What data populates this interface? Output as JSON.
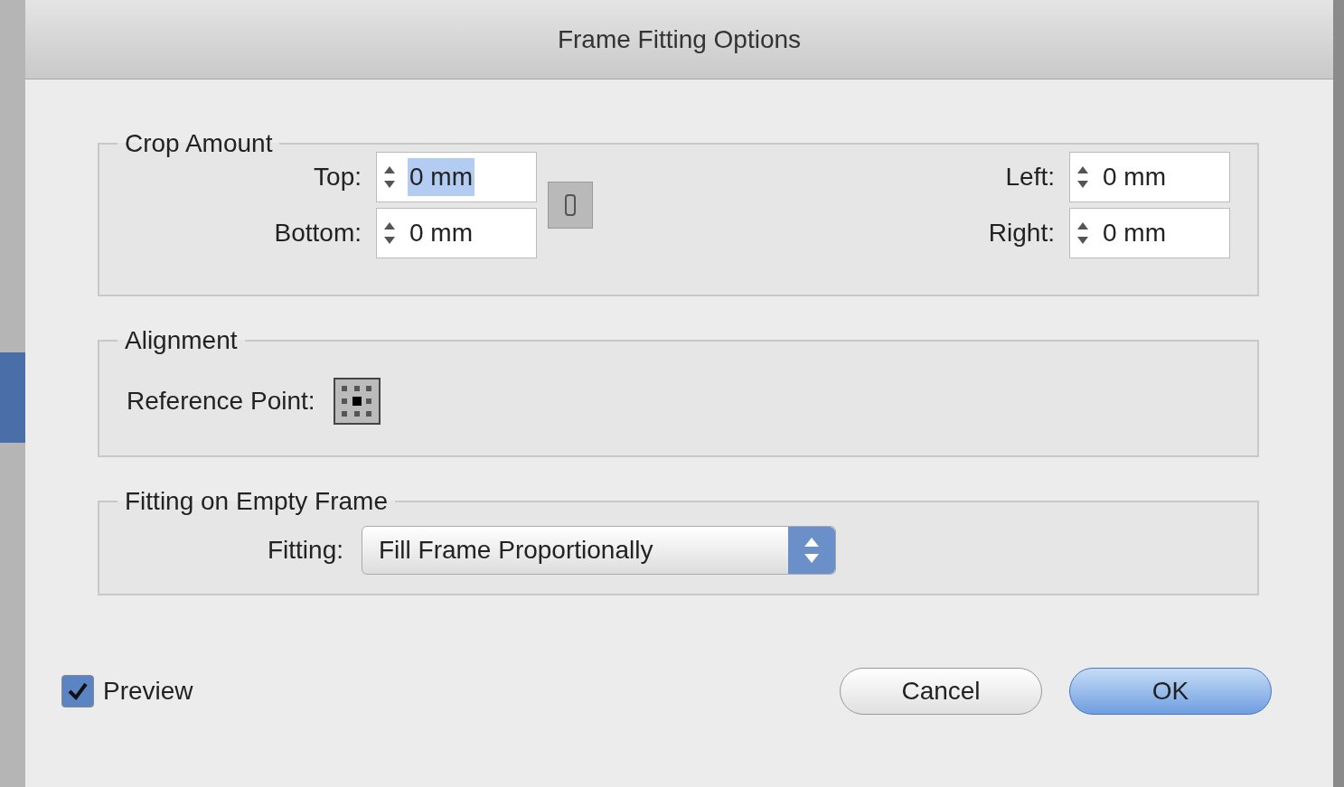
{
  "window": {
    "title": "Frame Fitting Options"
  },
  "crop_amount": {
    "title": "Crop Amount",
    "fields": [
      {
        "label": "Top:",
        "value": "0 mm",
        "highlighted": true
      },
      {
        "label": "Left:",
        "value": "0 mm",
        "highlighted": false
      },
      {
        "label": "Bottom:",
        "value": "0 mm",
        "highlighted": false
      },
      {
        "label": "Right:",
        "value": "0 mm",
        "highlighted": false
      }
    ]
  },
  "alignment": {
    "title": "Alignment",
    "label": "Reference Point:"
  },
  "fitting_group": {
    "title": "Fitting on Empty Frame",
    "label": "Fitting:",
    "value": "Fill Frame Proportionally"
  },
  "preview": {
    "label": "Preview",
    "checked": true
  },
  "buttons": [
    {
      "label": "Cancel",
      "default": false
    },
    {
      "label": "OK",
      "default": true
    }
  ]
}
